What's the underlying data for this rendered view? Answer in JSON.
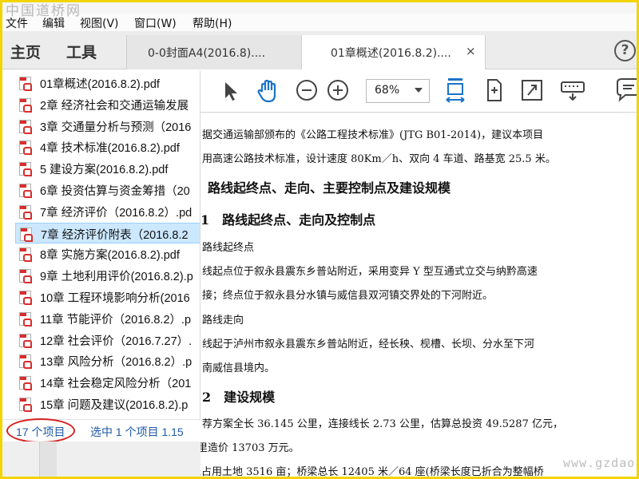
{
  "watermark_top": "中国道桥网",
  "watermark_bottom": "www.gzdao.com",
  "menu": [
    "文件",
    "编辑",
    "视图(V)",
    "窗口(W)",
    "帮助(H)"
  ],
  "nav_tabs": {
    "home": "主页",
    "tools": "工具"
  },
  "doc_tabs": [
    {
      "label": "0-0封面A4(2016.8)...."
    },
    {
      "label": "01章概述(2016.8.2)...."
    }
  ],
  "tab_close_symbol": "×",
  "help_symbol": "?",
  "toolbar": {
    "zoom_value": "68%",
    "icons": [
      "select-arrow-icon",
      "hand-icon",
      "zoom-out-icon",
      "zoom-in-icon",
      "fit-width-icon",
      "rotate-page-icon",
      "fullscreen-icon",
      "keyboard-icon",
      "comment-icon"
    ]
  },
  "files": [
    "01章概述(2016.8.2).pdf",
    "2章 经济社会和交通运输发展",
    "3章 交通量分析与预测（2016",
    "4章 技术标准(2016.8.2).pdf",
    "5 建设方案(2016.8.2).pdf",
    "6章 投资估算与资金筹措（20",
    "7章 经济评价（2016.8.2）.pd",
    "7章 经济评价附表（2016.8.2",
    "8章  实施方案(2016.8.2).pdf",
    "9章 土地利用评价(2016.8.2).p",
    "10章 工程环境影响分析(2016",
    "11章 节能评价（2016.8.2）.p",
    "12章 社会评价（2016.7.27）.",
    "13章 风险分析（2016.8.2）.p",
    "14章 社会稳定风险分析（201",
    "15章 问题及建议(2016.8.2).p"
  ],
  "selected_file_index": 7,
  "status": {
    "count": "17 个项目",
    "selected": "选中 1 个项目  1.15"
  },
  "document": {
    "lines": [
      "据交通运输部颁布的《公路工程技术标准》(JTG B01-2014)，建议本项目",
      "用高速公路技术标准，设计速度 80Km／h、双向 4 车道、路基宽 25.5 米。",
      "路线起终点、走向、主要控制点及建设规模",
      "1　路线起终点、走向及控制点",
      "路线起终点",
      "线起点位于叙永县震东乡普站附近，采用变异 Y 型互通式立交与纳黔高速",
      "接；终点位于叙永县分水镇与威信县双河镇交界处的下河附近。",
      "路线走向",
      "线起于泸州市叙永县震东乡普站附近，经长秧、枧槽、长坝、分水至下河",
      "南威信县境内。",
      "2　建设规模",
      "荐方案全长 36.145 公里，连接线长 2.73 公里，估算总投资 49.5287 亿元，",
      "平均每公里造价 13703 万元。",
      "全线占用土地 3516 亩；桥梁总长 12405 米／64 座(桥梁长度已折合为整幅桥"
    ]
  }
}
